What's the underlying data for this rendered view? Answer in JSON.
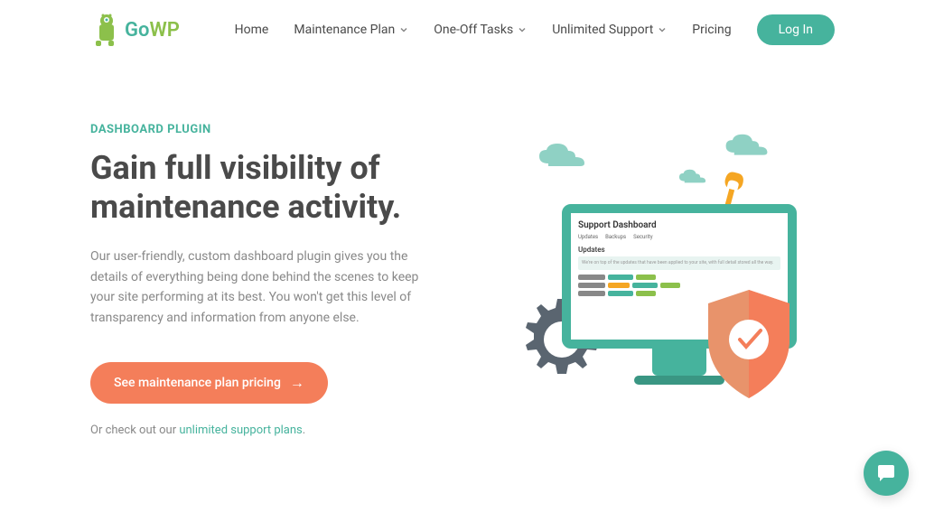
{
  "logo": {
    "text_go": "Go",
    "text_wp": "WP"
  },
  "nav": {
    "home": "Home",
    "maintenance": "Maintenance Plan",
    "tasks": "One-Off Tasks",
    "support": "Unlimited Support",
    "pricing": "Pricing",
    "login": "Log In"
  },
  "hero": {
    "eyebrow": "DASHBOARD PLUGIN",
    "heading": "Gain full visibility of maintenance activity.",
    "desc": "Our user-friendly, custom dashboard plugin gives you the details of everything being done behind the scenes to keep your site performing at its best. You won't get this level of transparency and information from anyone else.",
    "cta": "See maintenance plan pricing",
    "secondary_prefix": "Or check out our ",
    "secondary_link": "unlimited support plans",
    "secondary_suffix": "."
  },
  "dashboard": {
    "title": "Support Dashboard",
    "tab1": "Updates",
    "tab2": "Backups",
    "tab3": "Security",
    "section": "Updates",
    "box_text": "We're on top of the updates that have been applied to your site, with full detail stored all the way."
  }
}
